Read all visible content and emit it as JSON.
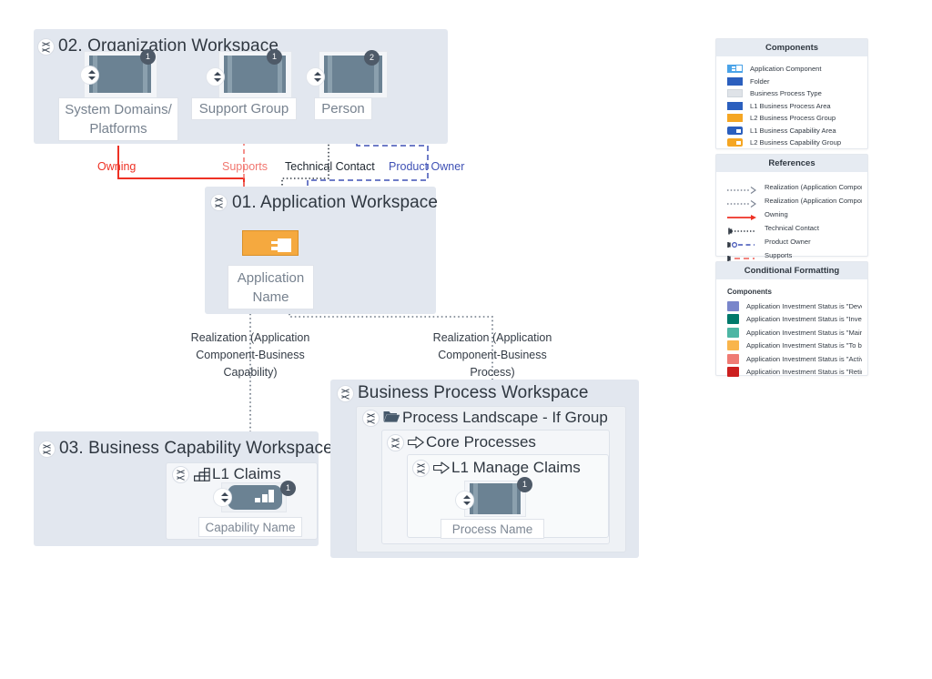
{
  "workspaces": {
    "organization": {
      "title": "02. Organization Workspace",
      "nodes": [
        {
          "label": "System Domains/ Platforms",
          "badge": "1"
        },
        {
          "label": "Support Group",
          "badge": "1"
        },
        {
          "label": "Person",
          "badge": "2"
        }
      ]
    },
    "application": {
      "title": "01. Application Workspace",
      "node_label": "Application Name"
    },
    "capability": {
      "title": "03. Business Capability Workspace",
      "group_title": "L1 Claims",
      "node_label": "Capability Name",
      "badge": "1"
    },
    "process": {
      "title": "Business Process Workspace",
      "level1_title": "Process Landscape - If Group",
      "level2_title": "Core Processes",
      "level3_title": "L1 Manage Claims",
      "node_label": "Process Name",
      "badge": "1"
    }
  },
  "connectors": [
    {
      "name": "owning",
      "label": "Owning",
      "color": "#ee3124"
    },
    {
      "name": "supports",
      "label": "Supports",
      "color": "#f1766f"
    },
    {
      "name": "technical-contact",
      "label": "Technical Contact",
      "color": "#222a33"
    },
    {
      "name": "product-owner",
      "label": "Product Owner",
      "color": "#3f51b5"
    },
    {
      "name": "realization-capability",
      "label": "Realization (Application Component-Business Capability)",
      "color": "#333b45"
    },
    {
      "name": "realization-process",
      "label": "Realization (Application Component-Business Process)",
      "color": "#333b45"
    }
  ],
  "connector_labels": {
    "realization_capability_lines": [
      "Realization (Application",
      "Component-Business",
      "Capability)"
    ],
    "realization_process_lines": [
      "Realization (Application",
      "Component-Business",
      "Process)"
    ]
  },
  "legend": {
    "components": {
      "title": "Components",
      "items": [
        {
          "label": "Application Component",
          "color": "#4aa3e8",
          "style": "appcomp"
        },
        {
          "label": "Folder",
          "color": "#2b5fbe",
          "style": "solid"
        },
        {
          "label": "Business Process Type",
          "color": "#dfe3e8",
          "style": "solid"
        },
        {
          "label": "L1 Business Process Area",
          "color": "#2b5fbe",
          "style": "solid"
        },
        {
          "label": "L2 Business Process Group",
          "color": "#f5a623",
          "style": "solid"
        },
        {
          "label": "L1 Business Capability Area",
          "color": "#2b5fbe",
          "style": "cap"
        },
        {
          "label": "L2 Business Capability Group",
          "color": "#f5a623",
          "style": "cap"
        }
      ]
    },
    "references": {
      "title": "References",
      "items": [
        {
          "label": "Realization (Application Component-B...",
          "style": "dotted-arrow",
          "color": "#7b8493"
        },
        {
          "label": "Realization (Application Component-B...",
          "style": "dotted-arrow",
          "color": "#7b8493"
        },
        {
          "label": "Owning",
          "style": "solid-arrow",
          "color": "#ee3124"
        },
        {
          "label": "Technical Contact",
          "style": "bar-dotted",
          "color": "#333b45"
        },
        {
          "label": "Product Owner",
          "style": "circle-dashed",
          "color": "#3f51b5"
        },
        {
          "label": "Supports",
          "style": "bar-dashed",
          "color": "#f1766f"
        }
      ]
    },
    "conditional_formatting": {
      "title": "Conditional Formatting",
      "subtitle": "Components",
      "items": [
        {
          "label": "Application Investment Status is \"Develop...",
          "color": "#7986cb"
        },
        {
          "label": "Application Investment Status is \"Investing\"",
          "color": "#00796b"
        },
        {
          "label": "Application Investment Status is \"Maintain...",
          "color": "#4db6a4"
        },
        {
          "label": "Application Investment Status is \"To be ph...",
          "color": "#f9b54c"
        },
        {
          "label": "Application Investment Status is \"Actively ...",
          "color": "#ef7b74"
        },
        {
          "label": "Application Investment Status is \"Retired\"",
          "color": "#cc1f1f"
        }
      ]
    }
  }
}
